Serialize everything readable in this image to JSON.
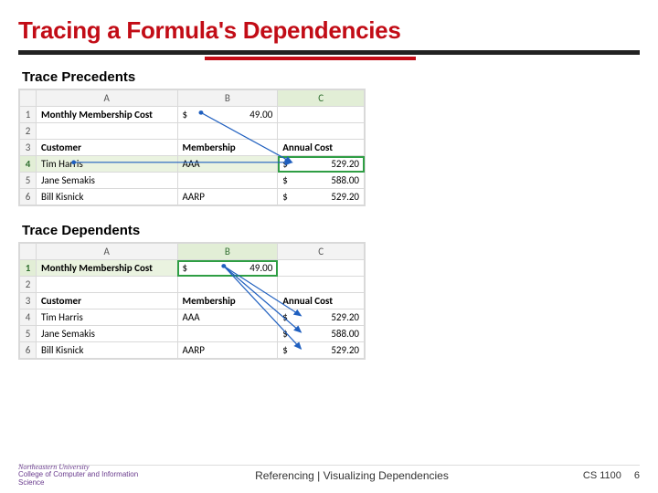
{
  "title": "Tracing a Formula's Dependencies",
  "section1": "Trace Precedents",
  "section2": "Trace Dependents",
  "columns": {
    "A": "A",
    "B": "B",
    "C": "C"
  },
  "rows": [
    "1",
    "2",
    "3",
    "4",
    "5",
    "6"
  ],
  "t1": {
    "r1": {
      "A": "Monthly Membership Cost",
      "Bdol": "$",
      "B": "49.00",
      "C": ""
    },
    "r3": {
      "A": "Customer",
      "B": "Membership",
      "C": "Annual Cost"
    },
    "r4": {
      "A": "Tim Harris",
      "B": "AAA",
      "Cdol": "$",
      "C": "529.20"
    },
    "r5": {
      "A": "Jane Semakis",
      "B": "",
      "Cdol": "$",
      "C": "588.00"
    },
    "r6": {
      "A": "Bill Kisnick",
      "B": "AARP",
      "Cdol": "$",
      "C": "529.20"
    }
  },
  "t2": {
    "r1": {
      "A": "Monthly Membership Cost",
      "Bdol": "$",
      "B": "49.00",
      "C": ""
    },
    "r3": {
      "A": "Customer",
      "B": "Membership",
      "C": "Annual Cost"
    },
    "r4": {
      "A": "Tim Harris",
      "B": "AAA",
      "Cdol": "$",
      "C": "529.20"
    },
    "r5": {
      "A": "Jane Semakis",
      "B": "",
      "Cdol": "$",
      "C": "588.00"
    },
    "r6": {
      "A": "Bill Kisnick",
      "B": "AARP",
      "Cdol": "$",
      "C": "529.20"
    }
  },
  "footer": {
    "brand1": "Northeastern University",
    "brand2": "College of Computer and Information Science",
    "center": "Referencing | Visualizing Dependencies",
    "course": "CS 1100",
    "page": "6"
  }
}
